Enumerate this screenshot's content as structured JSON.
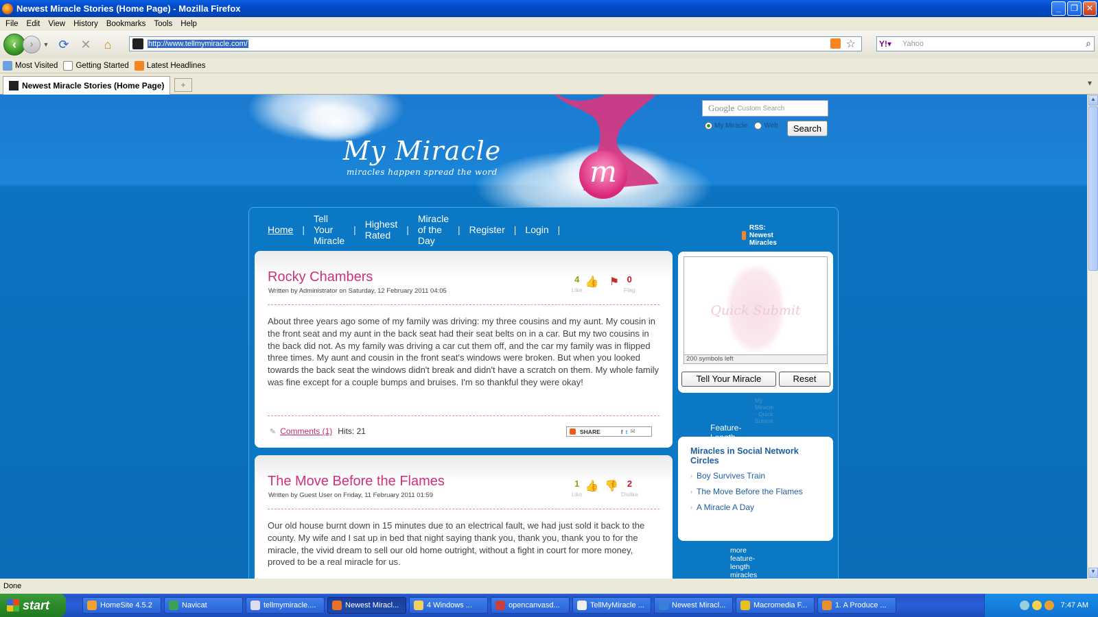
{
  "window": {
    "title": "Newest Miracle Stories (Home Page) - Mozilla Firefox"
  },
  "menu": [
    "File",
    "Edit",
    "View",
    "History",
    "Bookmarks",
    "Tools",
    "Help"
  ],
  "nav": {
    "url": "http://www.tellmymiracle.com/",
    "search_placeholder": "Yahoo"
  },
  "bookmarks": [
    "Most Visited",
    "Getting Started",
    "Latest Headlines"
  ],
  "tab": {
    "label": "Newest Miracle Stories (Home Page)"
  },
  "site": {
    "logo": "My Miracle",
    "tagline": "miracles happen    spread the word",
    "search": {
      "placeholder": "Custom Search",
      "google": "Google",
      "opt1": "My Miracle",
      "opt2": "Web",
      "button": "Search"
    },
    "topnav": [
      "Home",
      "Tell Your Miracle",
      "Highest Rated",
      "Miracle of the Day",
      "Register",
      "Login"
    ],
    "rss": "RSS: Newest Miracles",
    "articles": [
      {
        "title": "Rocky Chambers",
        "meta": "Written by Administrator on Saturday, 12 February 2011 04:05",
        "likes": "4",
        "like_label": "Like",
        "flags": "0",
        "flag_label": "Flag",
        "body": "About three years ago some of my family was driving: my three cousins and my aunt. My cousin in the front seat and my aunt in the back seat had their seat belts on in a car. But my two cousins in the back did not. As my family was driving a car cut them off, and the car my family was in flipped three times. My aunt and cousin in the front seat's windows were broken. But when you looked towards the back seat the windows didn't break and didn't have a scratch on them. My whole family was fine except for a couple bumps and bruises. I'm so thankful they were okay!",
        "comments": "Comments (1)",
        "hits": "Hits: 21",
        "share": "SHARE"
      },
      {
        "title": "The Move Before the Flames",
        "meta": "Written by Guest User on Friday, 11 February 2011 01:59",
        "likes": "1",
        "like_label": "Like",
        "dislikes": "2",
        "dislike_label": "Dislike",
        "body": "Our old house burnt down in 15 minutes due to an electrical fault, we had just sold it back to the county. My wife and I sat up in bed that night saying thank you, thank you, thank you to for the miracle, the vivid dream to sell our old home outright, without a fight in court for more money, proved to be a real miracle for us."
      }
    ],
    "quick": {
      "watermark": "Quick Submit",
      "count": "200 symbols left",
      "submit": "Tell Your Miracle",
      "reset": "Reset",
      "credit": "My Miracle - Quick Submit"
    },
    "feature": {
      "heading": "Feature-Length Miracle Stories",
      "title": "Miracles in Social Network Circles",
      "links": [
        "Boy Survives Train",
        "The Move Before the Flames",
        "A Miracle A Day"
      ],
      "more": "more feature-length miracles"
    }
  },
  "status": "Done",
  "taskbar": {
    "start": "start",
    "items": [
      "HomeSite 4.5.2",
      "Navicat",
      "tellmymiracle....",
      "Newest Miracl...",
      "4 Windows ...",
      "opencanvasd...",
      "TellMyMiracle ...",
      "Newest Miracl...",
      "Macromedia F...",
      "1. A Produce ..."
    ],
    "clock": "7:47 AM"
  }
}
